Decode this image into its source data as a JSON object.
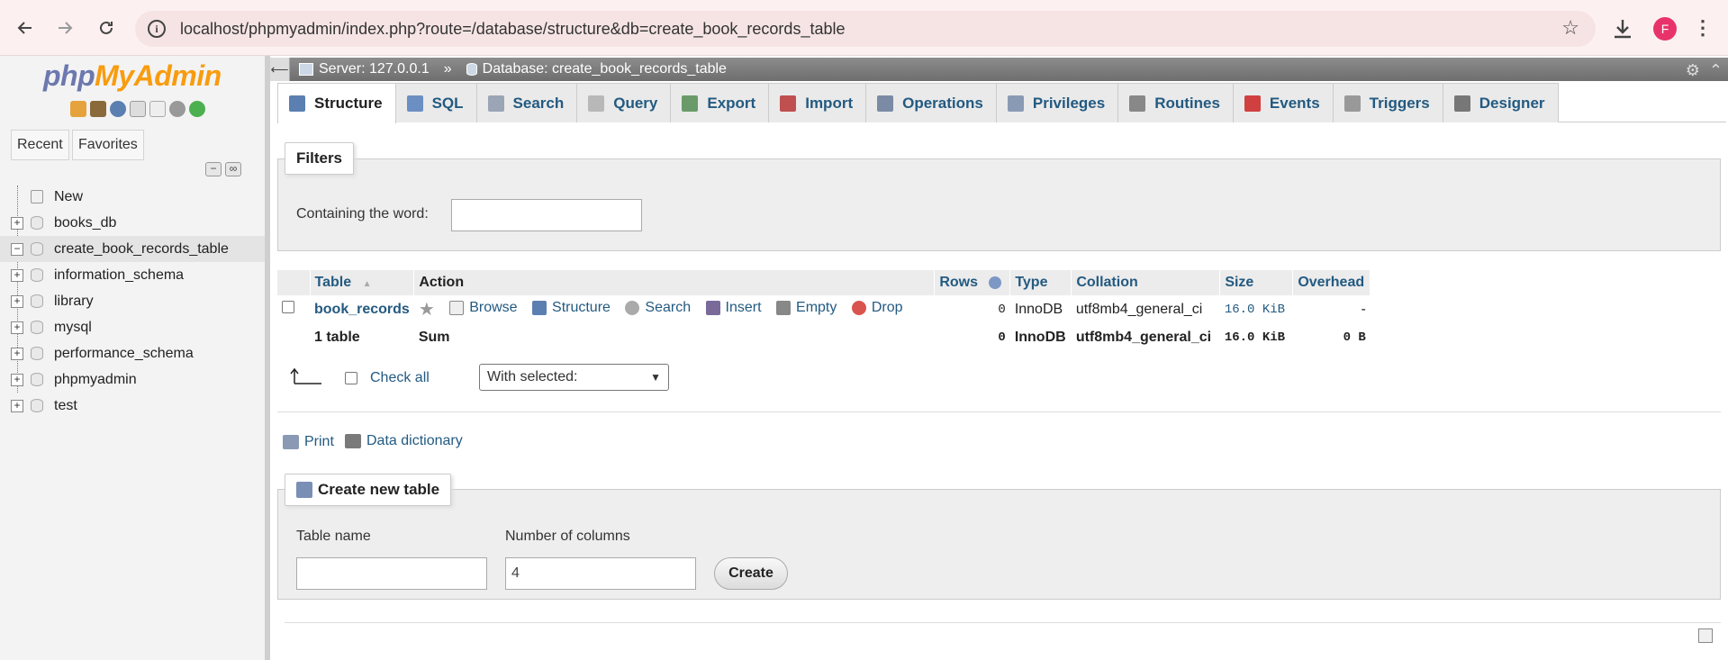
{
  "browser": {
    "url": "localhost/phpmyadmin/index.php?route=/database/structure&db=create_book_records_table",
    "avatar_letter": "F"
  },
  "sidebar": {
    "logo": {
      "php": "php",
      "my": "My",
      "admin": "Admin"
    },
    "recent_label": "Recent",
    "favorites_label": "Favorites",
    "items": [
      {
        "label": "New"
      },
      {
        "label": "books_db"
      },
      {
        "label": "create_book_records_table"
      },
      {
        "label": "information_schema"
      },
      {
        "label": "library"
      },
      {
        "label": "mysql"
      },
      {
        "label": "performance_schema"
      },
      {
        "label": "phpmyadmin"
      },
      {
        "label": "test"
      }
    ]
  },
  "breadcrumb": {
    "server": "Server: 127.0.0.1",
    "separator": "»",
    "database": "Database: create_book_records_table"
  },
  "tabs": [
    {
      "label": "Structure",
      "active": true,
      "color": "#5b7fb0"
    },
    {
      "label": "SQL",
      "color": "#6b8fc2"
    },
    {
      "label": "Search",
      "color": "#9aa5b5"
    },
    {
      "label": "Query",
      "color": "#b8b8b8"
    },
    {
      "label": "Export",
      "color": "#6a9a6a"
    },
    {
      "label": "Import",
      "color": "#c05050"
    },
    {
      "label": "Operations",
      "color": "#7b8ba5"
    },
    {
      "label": "Privileges",
      "color": "#8a9ab5"
    },
    {
      "label": "Routines",
      "color": "#888"
    },
    {
      "label": "Events",
      "color": "#d04040"
    },
    {
      "label": "Triggers",
      "color": "#999"
    },
    {
      "label": "Designer",
      "color": "#777"
    }
  ],
  "filters": {
    "legend": "Filters",
    "label": "Containing the word:",
    "value": ""
  },
  "table": {
    "headers": {
      "table": "Table",
      "action": "Action",
      "rows": "Rows",
      "type": "Type",
      "collation": "Collation",
      "size": "Size",
      "overhead": "Overhead"
    },
    "rows": [
      {
        "name": "book_records",
        "actions": [
          "Browse",
          "Structure",
          "Search",
          "Insert",
          "Empty",
          "Drop"
        ],
        "rows": "0",
        "type": "InnoDB",
        "collation": "utf8mb4_general_ci",
        "size": "16.0 KiB",
        "overhead": "-"
      }
    ],
    "summary": {
      "count": "1 table",
      "sum": "Sum",
      "rows": "0",
      "type": "InnoDB",
      "collation": "utf8mb4_general_ci",
      "size": "16.0 KiB",
      "overhead": "0 B"
    }
  },
  "bulk": {
    "check_all": "Check all",
    "with_selected": "With selected:"
  },
  "links": {
    "print": "Print",
    "data_dictionary": "Data dictionary"
  },
  "create_table": {
    "legend": "Create new table",
    "name_label": "Table name",
    "name_value": "",
    "columns_label": "Number of columns",
    "columns_value": "4",
    "button": "Create"
  }
}
